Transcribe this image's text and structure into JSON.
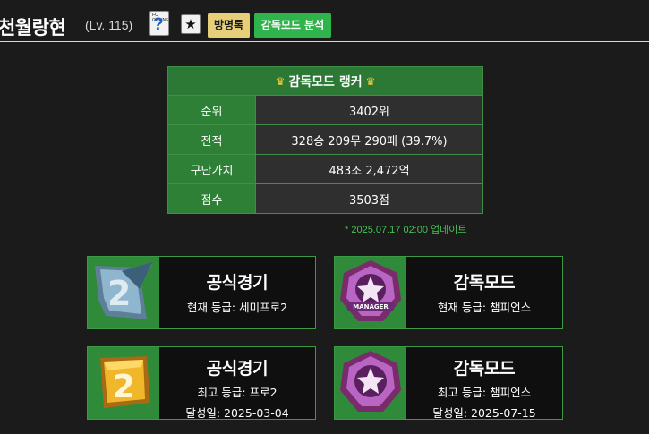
{
  "header": {
    "username": "천월랑현",
    "level": "(Lv. 115)",
    "question_icon_tag": "FC ONLINE",
    "question_icon_mark": "?",
    "star_icon": "★",
    "guestbook_label": "방명록",
    "analysis_label": "감독모드 분석"
  },
  "ranker_table": {
    "title": "감독모드 랭커",
    "crown_icon": "crown-icon",
    "rows": [
      {
        "label": "순위",
        "value": "3402위"
      },
      {
        "label": "전적",
        "value": "328승 209무 290패 (39.7%)"
      },
      {
        "label": "구단가치",
        "value": "483조 2,472억"
      },
      {
        "label": "점수",
        "value": "3503점"
      }
    ],
    "update_note": "* 2025.07.17 02:00 업데이트"
  },
  "cards": [
    {
      "title": "공식경기",
      "lines": [
        "현재 등급: 세미프로2"
      ],
      "icon": "semipro2-badge-icon"
    },
    {
      "title": "감독모드",
      "lines": [
        "현재 등급: 챔피언스"
      ],
      "icon": "manager-champions-badge-icon",
      "badge_text": "MANAGER"
    },
    {
      "title": "공식경기",
      "lines": [
        "최고 등급: 프로2",
        "달성일: 2025-03-04"
      ],
      "icon": "pro2-badge-icon"
    },
    {
      "title": "감독모드",
      "lines": [
        "최고 등급: 챔피언스",
        "달성일: 2025-07-15"
      ],
      "icon": "champions-badge-icon"
    }
  ],
  "colors": {
    "background": "#1b1b1b",
    "accent_green": "#2c7935",
    "button_green": "#2fb34b",
    "button_gold": "#e7cf7a",
    "update_text": "#45c153"
  }
}
